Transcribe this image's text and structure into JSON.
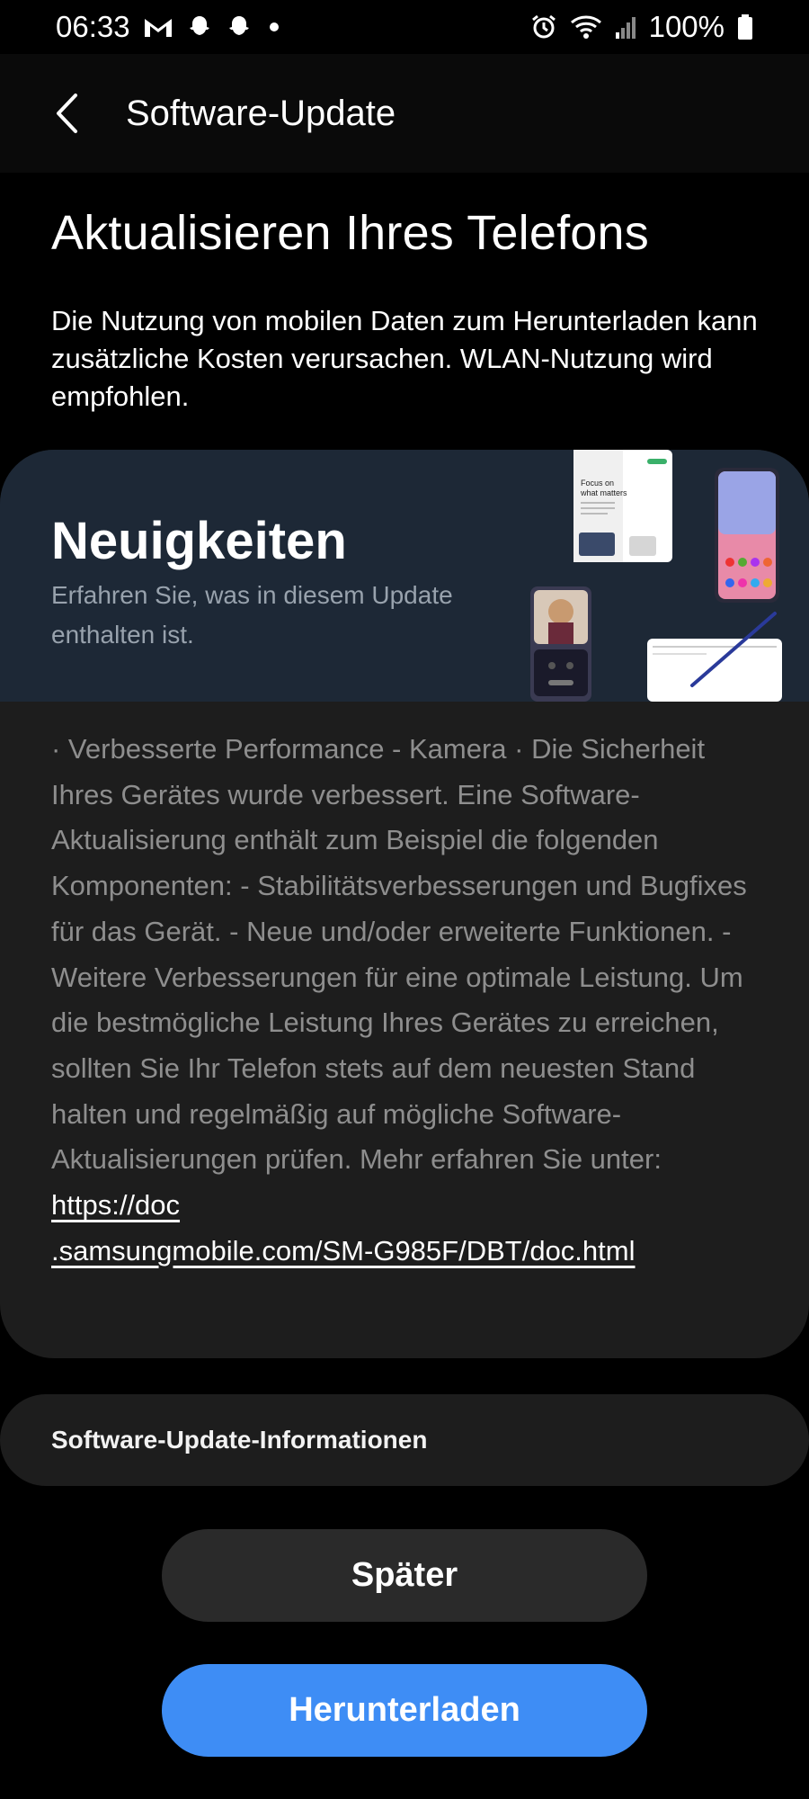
{
  "status_bar": {
    "time": "06:33",
    "battery": "100%",
    "icons": [
      "gmail-icon",
      "snapchat-icon",
      "snapchat-icon",
      "notification-dot-icon",
      "alarm-icon",
      "wifi-icon",
      "signal-icon",
      "battery-icon"
    ]
  },
  "app_bar": {
    "title": "Software-Update",
    "back_icon": "back-arrow-icon"
  },
  "headline": "Aktualisieren Ihres Telefons",
  "intro": "Die Nutzung von mobilen Daten zum Herunterladen kann zusätzliche Kosten verursachen. WLAN-Nutzung wird empfohlen.",
  "news": {
    "title": "Neuigkeiten",
    "subtitle": "Erfahren Sie, was in diesem Update enthalten ist.",
    "banner_color": "#1d2836",
    "body": "· Verbesserte Performance - Kamera · Die Sicherheit Ihres Gerätes wurde verbessert. Eine Software-Aktualisierung enthält zum Beispiel die folgenden Komponenten: - Stabilitätsverbesserungen und Bugfixes für das Gerät. - Neue und/oder erweiterte Funktionen. - Weitere Verbesserungen für eine optimale Leistung. Um die bestmögliche Leistung Ihres Gerätes zu erreichen, sollten Sie Ihr Telefon stets auf dem neuesten Stand halten und regelmäßig auf mögliche Software-Aktualisierungen prüfen. Mehr erfahren Sie unter: ",
    "link_part1": "https://doc",
    "link_part2": ".samsungmobile.com/SM-G985F/DBT/doc.html",
    "banner_texts": {
      "tablet_headline_1": "Focus on",
      "tablet_headline_2": "what matters"
    }
  },
  "info_row": {
    "label": "Software-Update-Informationen"
  },
  "buttons": {
    "later": "Später",
    "download": "Herunterladen"
  },
  "colors": {
    "background": "#000000",
    "card": "#1d1d1d",
    "accent": "#3e8df5",
    "body_text": "#8e8e8e"
  }
}
